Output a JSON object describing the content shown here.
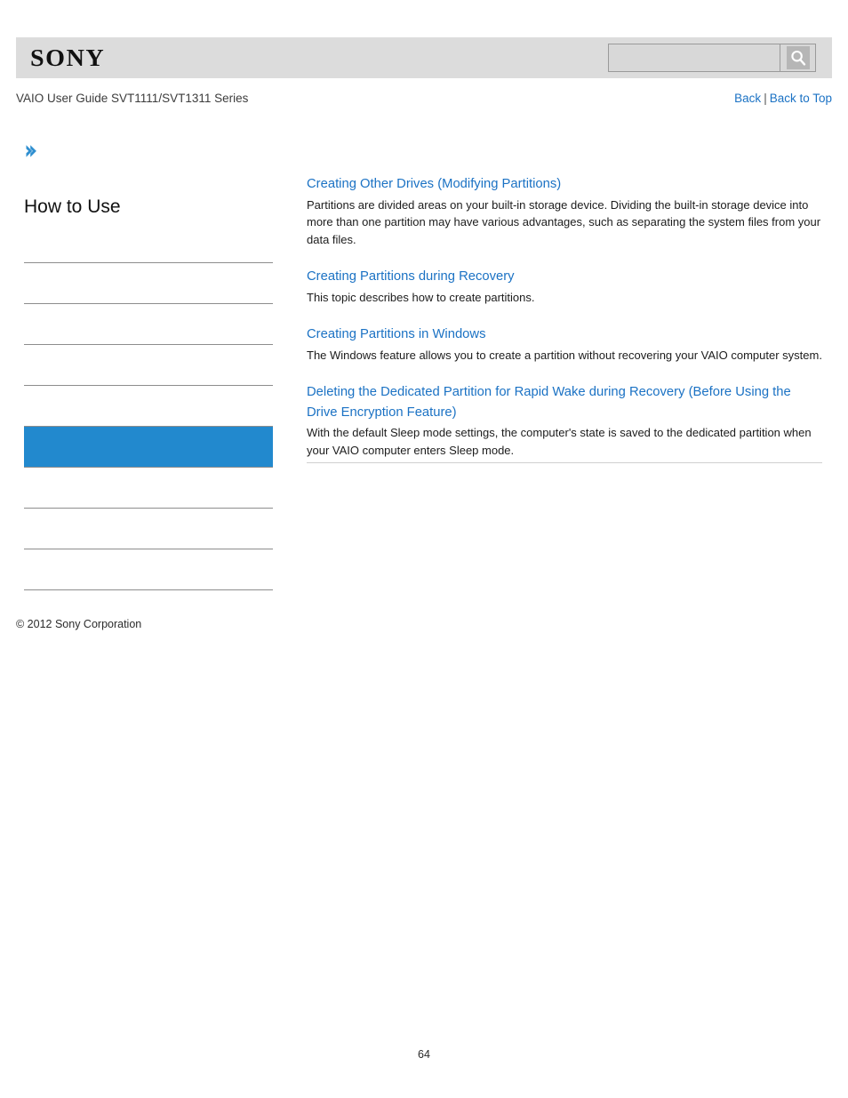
{
  "header": {
    "logo_text": "SONY",
    "logo_icon": "sony-wordmark",
    "search": {
      "value": "",
      "placeholder": "",
      "icon": "search-magnifier-icon"
    }
  },
  "breadcrumb": {
    "title": "VAIO User Guide SVT1111/SVT1311 Series",
    "back_label": "Back",
    "separator": "|",
    "back_to_top_label": "Back to Top"
  },
  "sidebar": {
    "nav_arrow_icon": "chevron-right-icon",
    "title": "How to Use",
    "items": [
      {
        "label": "",
        "selected": false
      },
      {
        "label": "",
        "selected": false
      },
      {
        "label": "",
        "selected": false
      },
      {
        "label": "",
        "selected": false
      },
      {
        "label": "",
        "selected": false
      },
      {
        "label": "",
        "selected": true
      },
      {
        "label": "",
        "selected": false
      },
      {
        "label": "",
        "selected": false
      },
      {
        "label": "",
        "selected": false
      }
    ],
    "selected_color": "#2289ce",
    "copyright": "© 2012 Sony Corporation"
  },
  "main": {
    "topics": [
      {
        "title": "Creating Other Drives (Modifying Partitions)",
        "description": "Partitions are divided areas on your built-in storage device. Dividing the built-in storage device into more than one partition may have various advantages, such as separating the system files from your data files."
      },
      {
        "title": "Creating Partitions during Recovery",
        "description": "This topic describes how to create partitions."
      },
      {
        "title": "Creating Partitions in Windows",
        "description": "The Windows feature allows you to create a partition without recovering your VAIO computer system."
      },
      {
        "title": "Deleting the Dedicated Partition for Rapid Wake during Recovery (Before Using the Drive Encryption Feature)",
        "description": "With the default Sleep mode settings, the computer's state is saved to the dedicated partition when your VAIO computer enters Sleep mode."
      }
    ]
  },
  "footer": {
    "page_number": "64"
  },
  "colors": {
    "link": "#1b72c4",
    "accent": "#2289ce",
    "header_band": "#dcdcdc",
    "rule": "#8d8d8d"
  }
}
